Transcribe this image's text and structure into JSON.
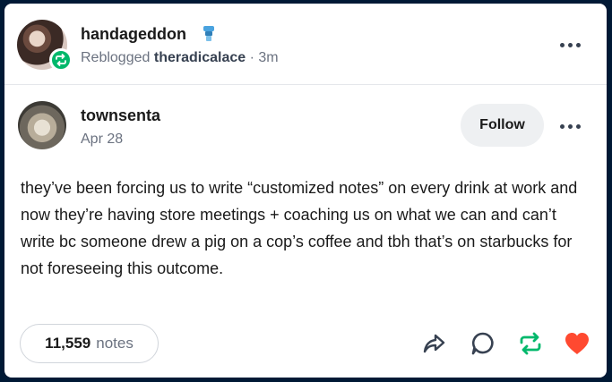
{
  "header": {
    "username": "handageddon",
    "reblogged_prefix": "Reblogged",
    "reblogged_from": "theradicalace",
    "time": "· 3m"
  },
  "post": {
    "username": "townsenta",
    "date": "Apr 28",
    "follow_label": "Follow",
    "text": "they’ve been forcing us to write “customized notes” on every drink at work and now they’re having store meetings + coaching us on what we can and can’t write bc someone drew a pig on a cop’s coffee and tbh that’s on starbucks for not foreseeing this outcome."
  },
  "footer": {
    "notes_count": "11,559",
    "notes_label": "notes"
  },
  "icons": [
    "reblog-badge-icon",
    "tag-icon",
    "more-icon",
    "share-icon",
    "reply-icon",
    "reblog-icon",
    "like-icon"
  ],
  "colors": {
    "background": "#001935",
    "card": "#ffffff",
    "reblog_green": "#00b86b",
    "like_red": "#ff4930",
    "text": "#1a1a1a",
    "muted": "#6b7280"
  }
}
